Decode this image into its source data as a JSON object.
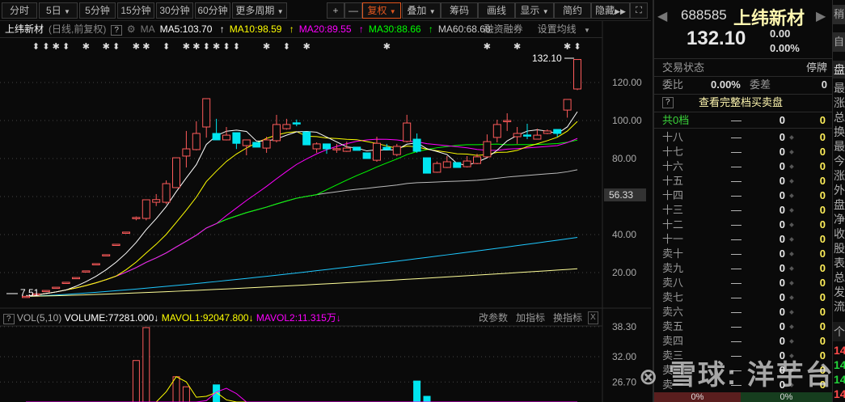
{
  "toolbar": {
    "periods": [
      "分时",
      "5日",
      "5分钟",
      "15分钟",
      "30分钟",
      "60分钟",
      "更多周期"
    ],
    "zoom_in": "+",
    "zoom_out": "—",
    "fuquan": "复权",
    "overlay": "叠加",
    "chips": "筹码",
    "draw": "画线",
    "display": "显示",
    "simple": "简约",
    "hide": "隐藏"
  },
  "infobar": {
    "name": "上纬新材",
    "mode": "(日线,前复权)",
    "help": "?",
    "ma_label": "MA",
    "ma5": "MA5:103.70",
    "ma10": "MA10:98.59",
    "ma20": "MA20:89.55",
    "ma30": "MA30:88.66",
    "ma60": "MA60:68.68",
    "margin": "融资融券",
    "set_ma": "设置均线"
  },
  "colors": {
    "up": "#ff5b5b",
    "down": "#00e5f0",
    "ma5": "#ffffff",
    "ma10": "#ffff00",
    "ma20": "#ff00ff",
    "ma30": "#00ff00",
    "ma60": "#bbbbbb"
  },
  "chart_data": {
    "type": "candlestick",
    "y_ticks": [
      "120.00",
      "100.00",
      "80.00",
      "40.00",
      "20.00"
    ],
    "y_tick_values": [
      120,
      100,
      80,
      40,
      20
    ],
    "current_marker": "56.33",
    "high_label": "132.10",
    "low_label": "7.51",
    "candles": [
      [
        7.51,
        7.51,
        7.51,
        7.51
      ],
      [
        8.85,
        8.85,
        8.85,
        8.85
      ],
      [
        10.6,
        10.6,
        10.6,
        10.6
      ],
      [
        12.3,
        12.3,
        12.3,
        12.3
      ],
      [
        14.9,
        14.9,
        14.9,
        14.9
      ],
      [
        17.4,
        17.4,
        17.4,
        17.4
      ],
      [
        20.9,
        20.9,
        20.9,
        20.9
      ],
      [
        24.7,
        24.7,
        24.7,
        24.7
      ],
      [
        29.4,
        29.4,
        29.4,
        29.4
      ],
      [
        34.9,
        34.9,
        34.9,
        34.9
      ],
      [
        41.3,
        41.3,
        41.3,
        41.3
      ],
      [
        48.5,
        49.5,
        47.5,
        49
      ],
      [
        48.5,
        58.5,
        47.5,
        58.3
      ],
      [
        57,
        61.3,
        55,
        58.4
      ],
      [
        57,
        68.5,
        56,
        66.8
      ],
      [
        64.7,
        80.6,
        64.5,
        80.4
      ],
      [
        81.3,
        94.5,
        75.3,
        85.1
      ],
      [
        84.7,
        99.6,
        84.3,
        93.2
      ],
      [
        96.6,
        111.5,
        91,
        111.5
      ],
      [
        93.2,
        100.9,
        89.8,
        89.8
      ],
      [
        89.8,
        96.6,
        89.5,
        92.3
      ],
      [
        93.6,
        93.6,
        85,
        88
      ],
      [
        86.8,
        89.8,
        81.7,
        89.8
      ],
      [
        88.5,
        88.5,
        86,
        86
      ],
      [
        85.5,
        91.5,
        83,
        89.8
      ],
      [
        89.4,
        103,
        88.5,
        97.9
      ],
      [
        95.7,
        100.9,
        95.2,
        97.9
      ],
      [
        98.8,
        100.5,
        97,
        98.6
      ],
      [
        94,
        94,
        87.2,
        87.2
      ],
      [
        85.1,
        88.5,
        83,
        87.7
      ],
      [
        87.7,
        87.7,
        82.5,
        85.1
      ],
      [
        85,
        87.7,
        83,
        85.2
      ],
      [
        83.8,
        88.9,
        83.5,
        85.5
      ],
      [
        86,
        86,
        84.3,
        84.3
      ],
      [
        83,
        83,
        80,
        80
      ],
      [
        79.1,
        91.5,
        78.3,
        88
      ],
      [
        85.9,
        87.7,
        84.6,
        84.6
      ],
      [
        82.1,
        87.7,
        81.2,
        86.4
      ],
      [
        89,
        103,
        88.5,
        98.7
      ],
      [
        90.2,
        93.2,
        83,
        83.8
      ],
      [
        80.4,
        80.4,
        72.3,
        72.3
      ],
      [
        72.8,
        78.5,
        72.5,
        77.4
      ],
      [
        75.3,
        81.3,
        75,
        78.3
      ],
      [
        77.9,
        77.9,
        75.3,
        75.3
      ],
      [
        75.7,
        81.3,
        75.3,
        78.7
      ],
      [
        77.4,
        82.5,
        77,
        80.9
      ],
      [
        80.9,
        92.7,
        80.5,
        88.9
      ],
      [
        91.1,
        100.4,
        88.5,
        97.9
      ],
      [
        99.8,
        103.8,
        94.5,
        100
      ],
      [
        91.5,
        96.6,
        87.7,
        93.2
      ],
      [
        92.4,
        98.3,
        90.2,
        92.2
      ],
      [
        90.2,
        95.7,
        90,
        92.3
      ],
      [
        93.2,
        95.3,
        92.8,
        94.5
      ],
      [
        95.3,
        95.3,
        91.5,
        93.2
      ],
      [
        105.5,
        111.1,
        101.5,
        111.1
      ],
      [
        116.6,
        132.1,
        116,
        132.1
      ]
    ],
    "ma_periods": [
      5,
      10,
      20,
      30,
      60
    ],
    "extra_lines": [
      {
        "color": "#1ec8ff",
        "start": 7.51,
        "end": 38.5
      },
      {
        "color": "#ffff99",
        "start": 7.51,
        "end": 22
      }
    ],
    "markers": [
      [
        1,
        "⬍"
      ],
      [
        2,
        "⬍"
      ],
      [
        3,
        "✱"
      ],
      [
        4,
        "⬍"
      ],
      [
        6,
        "✱"
      ],
      [
        8,
        "✱"
      ],
      [
        9,
        "⬍"
      ],
      [
        11,
        "✱"
      ],
      [
        12,
        "✱"
      ],
      [
        14,
        "⬍"
      ],
      [
        16,
        "✱"
      ],
      [
        17,
        "✱"
      ],
      [
        18,
        "⬍"
      ],
      [
        19,
        "✱"
      ],
      [
        20,
        "⬍"
      ],
      [
        21,
        "⬍"
      ],
      [
        24,
        "✱"
      ],
      [
        26,
        "⬍"
      ],
      [
        28,
        "✱"
      ],
      [
        36,
        "✱"
      ],
      [
        46,
        "✱"
      ],
      [
        49,
        "✱"
      ],
      [
        54,
        "✱"
      ],
      [
        55,
        "⬍"
      ]
    ],
    "volume": {
      "header": {
        "help": "?",
        "name": "VOL(5,10)",
        "volume": "VOLUME:77281.000",
        "mavol1": "MAVOL1:92047.800",
        "mavol2": "MAVOL2:11.315万",
        "arrow": "↓",
        "edit": "改参数",
        "add": "加指标",
        "swap": "换指标",
        "close": "X"
      },
      "y_ticks": [
        "38.30",
        "32.00",
        "26.70"
      ],
      "y_tick_values": [
        38.3,
        32,
        26.7
      ],
      "values": [
        2,
        3,
        3,
        3,
        3,
        3,
        4,
        5,
        6,
        8,
        12,
        31.2,
        38.1,
        20,
        22,
        27.8,
        25.7,
        22,
        21,
        26.1,
        20,
        20,
        19,
        18,
        18,
        22,
        19,
        17,
        20,
        18,
        17,
        16,
        16,
        15,
        15,
        20,
        16,
        16,
        20,
        26.9,
        23.7,
        20,
        17,
        15,
        14,
        14,
        15,
        18,
        19,
        18,
        16,
        15,
        14,
        15,
        19,
        22
      ]
    }
  },
  "quote": {
    "code": "688585",
    "name": "上纬新材",
    "price": "132.10",
    "change": "0.00",
    "change_pct": "0.00%",
    "side_btn1": "稍",
    "side_btn2": "自",
    "status_label": "交易状态",
    "status": "停牌",
    "tab": "盘",
    "ratio_label": "委比",
    "ratio": "0.00%",
    "diff_label": "委差",
    "diff": "0",
    "full_help": "?",
    "full_label": "查看完整档买卖盘",
    "total_label": "共0档",
    "total_dash": "—",
    "total_v1": "0",
    "total_v2": "0",
    "levels": [
      "十八",
      "十七",
      "十六",
      "十五",
      "十四",
      "十三",
      "十二",
      "十一",
      "卖十",
      "卖九",
      "卖八",
      "卖七",
      "卖六",
      "卖五",
      "卖四",
      "卖三",
      "卖二",
      "卖一"
    ],
    "level_dash": "—",
    "level_v": "0",
    "bar_left": "0%",
    "bar_right": "0%",
    "side_labels": [
      "最",
      "涨",
      "总",
      "换",
      "最",
      "今",
      "涨",
      "外",
      "盘",
      "净",
      "收",
      "股",
      "表",
      "总",
      "发",
      "流"
    ],
    "side_tab": "个",
    "side_values": [
      "14",
      "14",
      "14",
      "14"
    ]
  },
  "watermark": "雪球: 洋芋台"
}
